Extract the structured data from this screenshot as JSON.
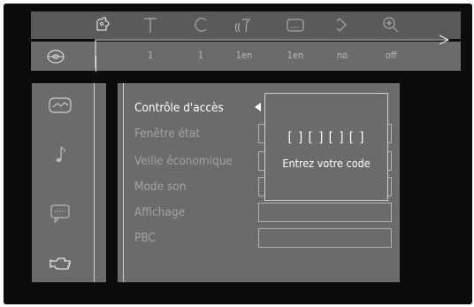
{
  "toolbar": {
    "icons": [
      "audio-hand-icon",
      "subtitle-t-icon",
      "chapter-c-icon",
      "audio-language-icon",
      "subtitle-box-icon",
      "angle-icon",
      "zoom-icon"
    ],
    "values": [
      "1",
      "1",
      "1en",
      "1en",
      "no",
      "off"
    ]
  },
  "sidebar": {
    "items": [
      "picture-settings-icon",
      "music-note-icon",
      "speech-bubble-icon",
      "preferences-hand-icon"
    ]
  },
  "menu": {
    "items": [
      {
        "label": "Contrôle d'accès",
        "active": true
      },
      {
        "label": "Fenêtre état",
        "active": false
      },
      {
        "label": "Veille économique",
        "active": false
      },
      {
        "label": "Mode son",
        "active": false
      },
      {
        "label": "Affichage",
        "active": false
      },
      {
        "label": "PBC",
        "active": false
      }
    ]
  },
  "dialog": {
    "code": "[ ] [ ] [ ] [ ]",
    "prompt": "Entrez votre code"
  }
}
